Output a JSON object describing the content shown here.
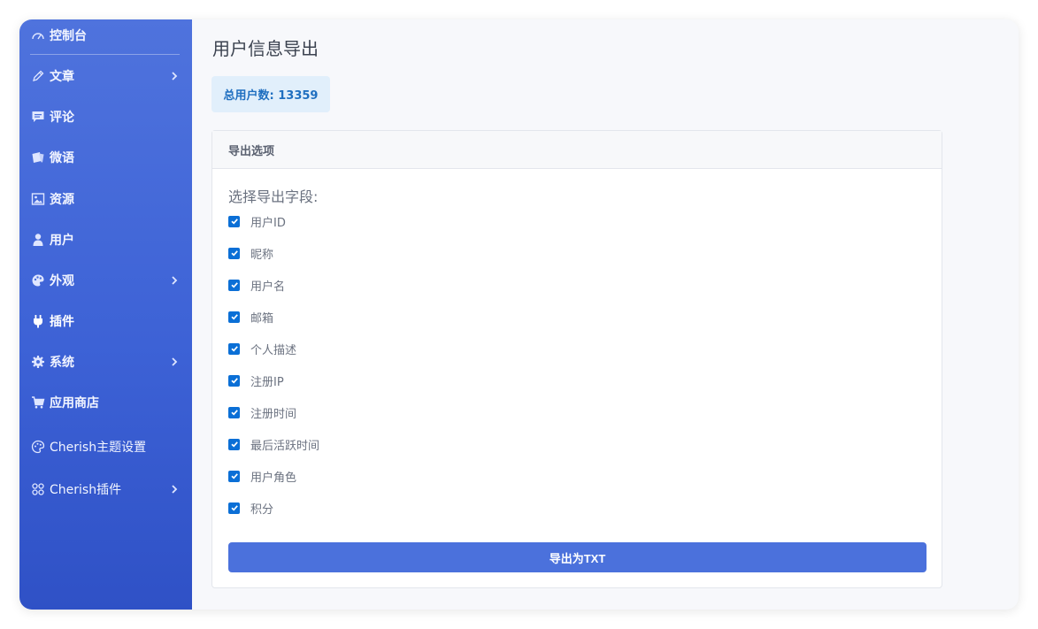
{
  "sidebar": {
    "items": [
      {
        "label": "控制台",
        "icon": "dashboard-icon"
      },
      {
        "label": "文章",
        "icon": "pencil-icon",
        "expandable": true
      },
      {
        "label": "评论",
        "icon": "comment-icon"
      },
      {
        "label": "微语",
        "icon": "notes-icon"
      },
      {
        "label": "资源",
        "icon": "image-icon"
      },
      {
        "label": "用户",
        "icon": "user-icon"
      },
      {
        "label": "外观",
        "icon": "palette-icon",
        "expandable": true
      },
      {
        "label": "插件",
        "icon": "plug-icon",
        "active": true
      },
      {
        "label": "系统",
        "icon": "gear-icon",
        "expandable": true
      },
      {
        "label": "应用商店",
        "icon": "cart-icon"
      },
      {
        "label": "Cherish主题设置",
        "icon": "theme-palette-icon"
      },
      {
        "label": "Cherish插件",
        "icon": "apps-icon",
        "expandable": true
      }
    ]
  },
  "main": {
    "title": "用户信息导出",
    "stat": "总用户数: 13359",
    "card": {
      "header": "导出选项",
      "field_heading": "选择导出字段:",
      "fields": [
        {
          "label": "用户ID",
          "checked": true
        },
        {
          "label": "昵称",
          "checked": true
        },
        {
          "label": "用户名",
          "checked": true
        },
        {
          "label": "邮箱",
          "checked": true
        },
        {
          "label": "个人描述",
          "checked": true
        },
        {
          "label": "注册IP",
          "checked": true
        },
        {
          "label": "注册时间",
          "checked": true
        },
        {
          "label": "最后活跃时间",
          "checked": true
        },
        {
          "label": "用户角色",
          "checked": true
        },
        {
          "label": "积分",
          "checked": true
        }
      ],
      "export_label": "导出为TXT"
    }
  },
  "colors": {
    "sidebar_top": "#4f73dd",
    "sidebar_bottom": "#2f51c6",
    "accent": "#4b71dc",
    "checkbox": "#0b6fd6",
    "stat_text": "#1f6fc0"
  }
}
